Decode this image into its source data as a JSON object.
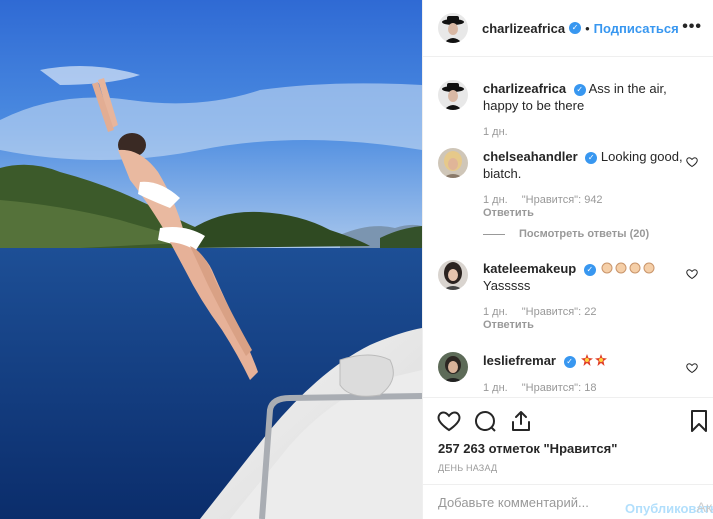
{
  "post": {
    "author": "charlizeafrica",
    "follow_label": "Подписаться",
    "separator": "•",
    "more_label": "•••",
    "likes_text": "257 263 отметок \"Нравится\"",
    "time_ago": "ДЕНЬ НАЗАД"
  },
  "caption": {
    "user": "charlizeafrica",
    "text": "Ass in the air, happy to be there",
    "age": "1 дн."
  },
  "comments": [
    {
      "user": "chelseahandler",
      "text": "Looking good, biatch.",
      "age": "1 дн.",
      "likes": "\"Нравится\": 942",
      "reply_label": "Ответить",
      "view_replies": "Посмотреть ответы (20)"
    },
    {
      "user": "kateleemakeup",
      "text": "Yasssss",
      "emoji": "clapping-hands x4",
      "age": "1 дн.",
      "likes": "\"Нравится\": 22",
      "reply_label": "Ответить"
    },
    {
      "user": "lesliefremar",
      "emoji": "collision x2",
      "age": "1 дн.",
      "likes": "\"Нравится\": 18"
    }
  ],
  "composer": {
    "placeholder": "Добавьте комментарий...",
    "publish_label": "Опубликовать",
    "watermark": "Ак"
  },
  "icons": {
    "like": "heart-icon",
    "comment": "comment-icon",
    "share": "share-icon",
    "save": "bookmark-icon",
    "verified": "verified-badge-icon"
  },
  "colors": {
    "accent": "#3897f0",
    "muted": "#999999",
    "publish_disabled": "#b2dffc"
  }
}
